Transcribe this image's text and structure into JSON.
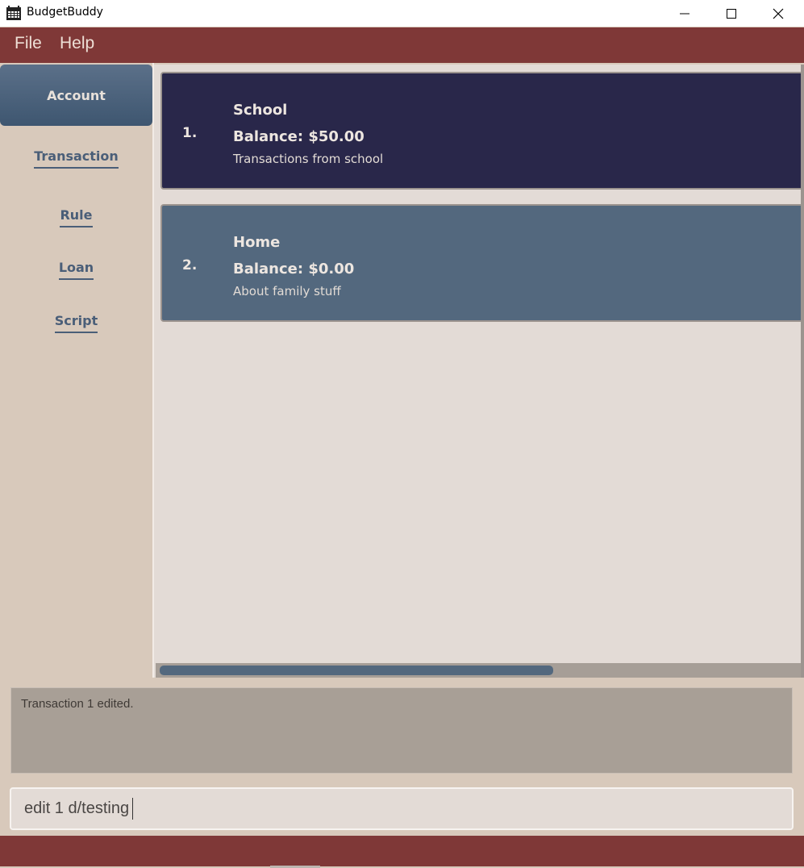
{
  "window": {
    "title": "BudgetBuddy",
    "minimize_icon": "minimize-icon",
    "maximize_icon": "maximize-icon",
    "close_icon": "close-icon"
  },
  "menu": {
    "items": [
      "File",
      "Help"
    ]
  },
  "sidebar": {
    "items": [
      {
        "label": "Account",
        "active": true
      },
      {
        "label": "Transaction",
        "active": false
      },
      {
        "label": "Rule",
        "active": false
      },
      {
        "label": "Loan",
        "active": false
      },
      {
        "label": "Script",
        "active": false
      }
    ]
  },
  "accounts": [
    {
      "index": "1.",
      "name": "School",
      "balance": "Balance: $50.00",
      "description": "Transactions from school"
    },
    {
      "index": "2.",
      "name": "Home",
      "balance": "Balance: $0.00",
      "description": "About family stuff"
    }
  ],
  "result_display": {
    "text": "Transaction 1 edited."
  },
  "command_box": {
    "value": "edit 1 d/testing"
  },
  "colors": {
    "menubar": "#7f3837",
    "card_selected": "#29274a",
    "card_default": "#53687e",
    "background": "#e3dbd6"
  }
}
